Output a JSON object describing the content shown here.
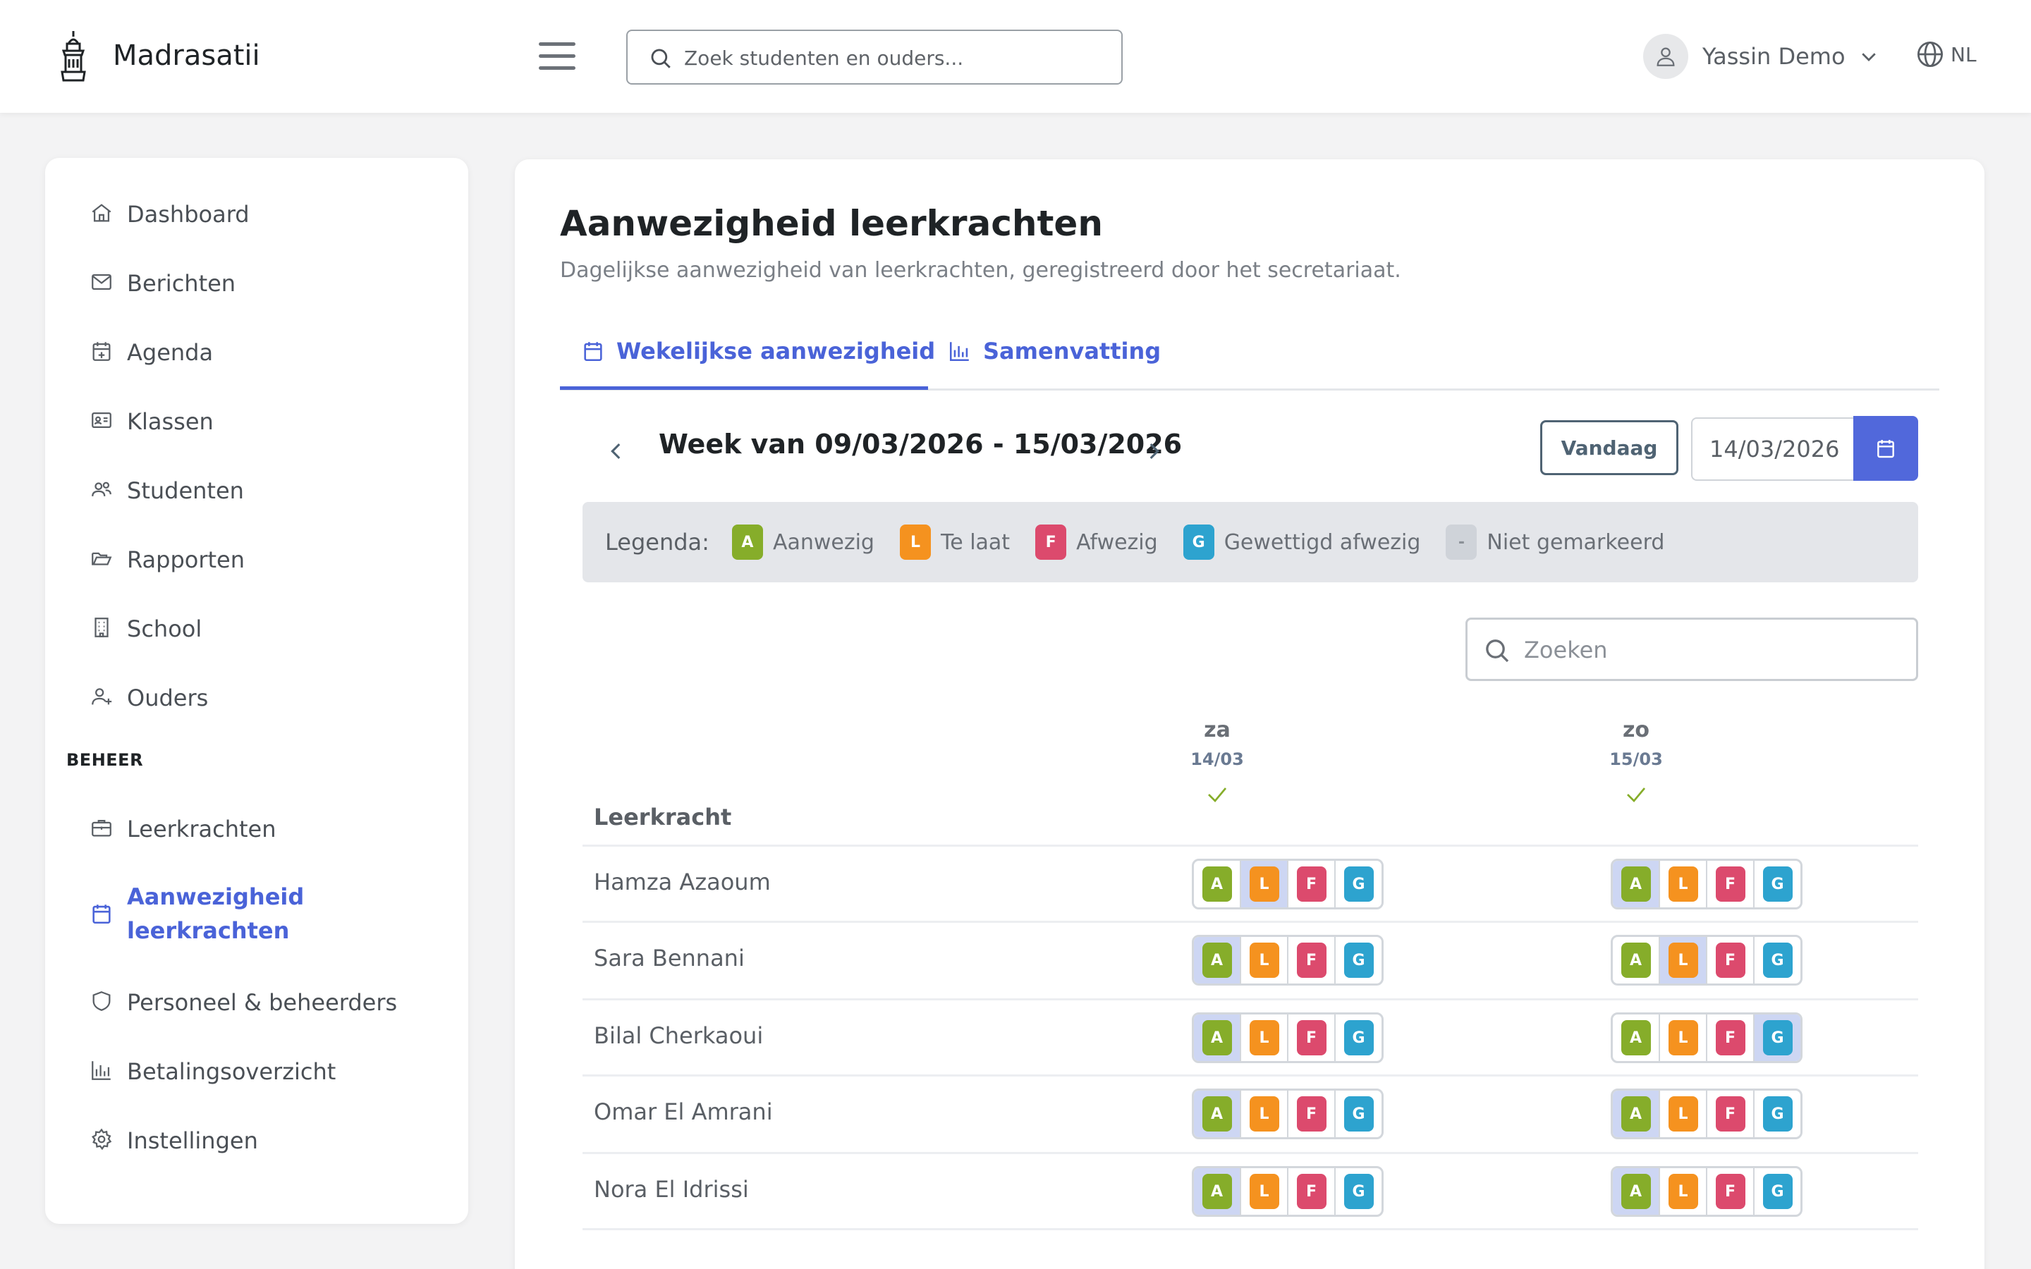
{
  "app": {
    "brand": "Madrasatii",
    "search_placeholder": "Zoek studenten en ouders...",
    "user_name": "Yassin Demo",
    "language": "NL"
  },
  "sidebar": {
    "items": [
      {
        "label": "Dashboard",
        "icon": "home-icon"
      },
      {
        "label": "Berichten",
        "icon": "mail-icon"
      },
      {
        "label": "Agenda",
        "icon": "calendar-plus-icon"
      },
      {
        "label": "Klassen",
        "icon": "id-card-icon"
      },
      {
        "label": "Studenten",
        "icon": "users-icon"
      },
      {
        "label": "Rapporten",
        "icon": "folder-open-icon"
      },
      {
        "label": "School",
        "icon": "building-icon"
      },
      {
        "label": "Ouders",
        "icon": "user-plus-icon"
      }
    ],
    "section_label": "BEHEER",
    "admin_items": [
      {
        "label": "Leerkrachten",
        "icon": "briefcase-icon"
      },
      {
        "label": "Aanwezigheid leerkrachten",
        "icon": "calendar-icon",
        "active": true
      },
      {
        "label": "Personeel & beheerders",
        "icon": "shield-icon"
      },
      {
        "label": "Betalingsoverzicht",
        "icon": "bar-chart-icon"
      },
      {
        "label": "Instellingen",
        "icon": "gear-icon"
      }
    ]
  },
  "page": {
    "title": "Aanwezigheid leerkrachten",
    "subtitle": "Dagelijkse aanwezigheid van leerkrachten, geregistreerd door het secretariaat.",
    "tabs": [
      {
        "label": "Wekelijkse aanwezigheid",
        "icon": "calendar-icon",
        "active": true
      },
      {
        "label": "Samenvatting",
        "icon": "bar-chart-icon"
      }
    ],
    "week_label": "Week van 09/03/2026 - 15/03/2026",
    "today_label": "Vandaag",
    "date_value": "14/03/2026",
    "legend": {
      "title": "Legenda:",
      "items": [
        {
          "code": "A",
          "label": "Aanwezig",
          "color": "#86ad2a"
        },
        {
          "code": "L",
          "label": "Te laat",
          "color": "#f5921f"
        },
        {
          "code": "F",
          "label": "Afwezig",
          "color": "#dc4a6d"
        },
        {
          "code": "G",
          "label": "Gewettigd afwezig",
          "color": "#2da3cf"
        },
        {
          "code": "-",
          "label": "Niet gemarkeerd",
          "color": "#cfd3d9"
        }
      ]
    },
    "table_search_placeholder": "Zoeken",
    "column_header": "Leerkracht",
    "days": [
      {
        "name": "za",
        "date": "14/03"
      },
      {
        "name": "zo",
        "date": "15/03"
      }
    ],
    "status_codes": [
      "A",
      "L",
      "F",
      "G"
    ],
    "rows": [
      {
        "name": "Hamza Azaoum",
        "selected": [
          "L",
          "A"
        ]
      },
      {
        "name": "Sara Bennani",
        "selected": [
          "A",
          "L"
        ]
      },
      {
        "name": "Bilal Cherkaoui",
        "selected": [
          "A",
          "G"
        ]
      },
      {
        "name": "Omar El Amrani",
        "selected": [
          "A",
          "A"
        ]
      },
      {
        "name": "Nora El Idrissi",
        "selected": [
          "A",
          "A"
        ]
      }
    ]
  },
  "colors": {
    "accent": "#4a63d8",
    "present": "#86ad2a",
    "late": "#f5921f",
    "absent": "#dc4a6d",
    "excused": "#2da3cf"
  }
}
